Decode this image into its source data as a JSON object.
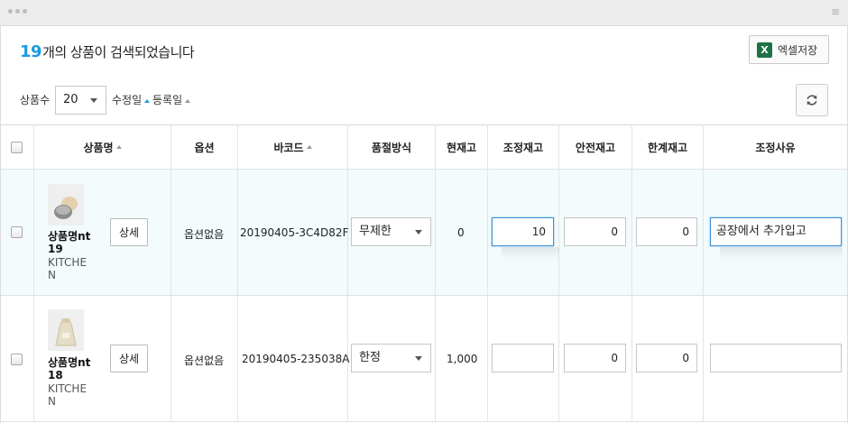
{
  "header": {
    "count_number": "19",
    "count_suffix": "개의 상품이 검색되었습니다",
    "excel_label": "엑셀저장",
    "excel_icon_letter": "X"
  },
  "filters": {
    "page_size_label": "상품수",
    "page_size_value": "20",
    "sort_modified_label": "수정일",
    "sort_registered_label": "등록일"
  },
  "columns": [
    "상품명",
    "옵션",
    "바코드",
    "품절방식",
    "현재고",
    "조정재고",
    "안전재고",
    "한계재고",
    "조정사유"
  ],
  "rows": [
    {
      "name": "상품명nt 19",
      "category": "KITCHE N",
      "detail_label": "상세",
      "option": "옵션없음",
      "barcode": "20190405-3C4D82F",
      "soldout": "무제한",
      "stock": "0",
      "adjust": "10",
      "safety": "0",
      "limit": "0",
      "reason": "공장에서 추가입고"
    },
    {
      "name": "상품명nt 18",
      "category": "KITCHE N",
      "detail_label": "상세",
      "option": "옵션없음",
      "barcode": "20190405-235038A",
      "soldout": "한정",
      "stock": "1,000",
      "adjust": "",
      "safety": "0",
      "limit": "0",
      "reason": ""
    }
  ],
  "colors": {
    "accent": "#1a9be0",
    "selected_row_bg": "#f3fbfd",
    "focus_border": "#3d8fd6",
    "excel_green": "#1e7145"
  }
}
